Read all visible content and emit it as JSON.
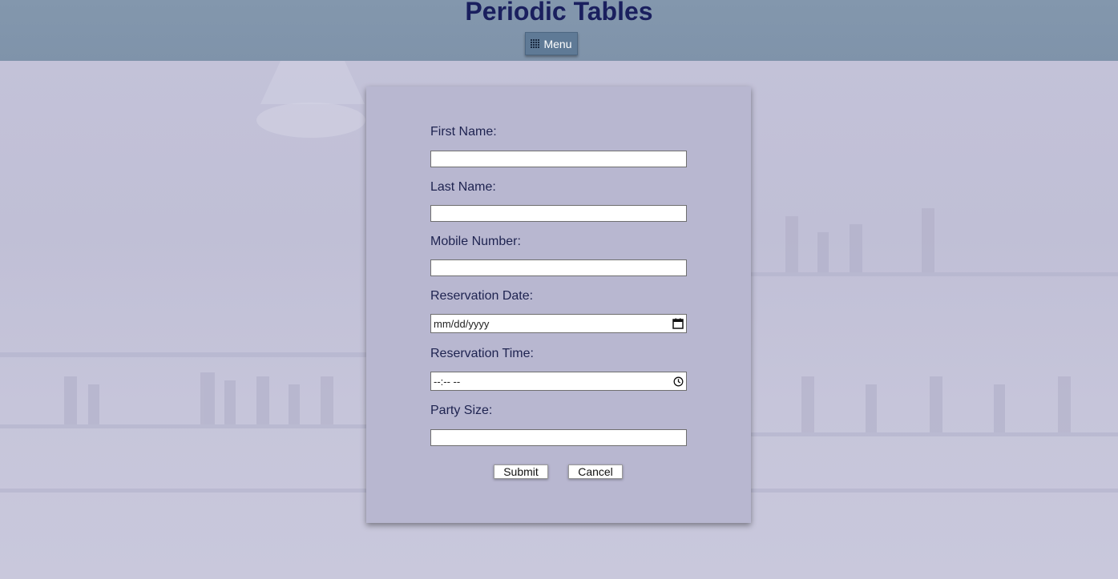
{
  "header": {
    "title": "Periodic Tables",
    "menu_label": "Menu",
    "menu_icon": "grid-icon"
  },
  "form": {
    "fields": [
      {
        "label": "First Name:",
        "value": "",
        "placeholder": ""
      },
      {
        "label": "Last Name:",
        "value": "",
        "placeholder": ""
      },
      {
        "label": "Mobile Number:",
        "value": "",
        "placeholder": ""
      },
      {
        "label": "Reservation Date:",
        "value": "",
        "placeholder": "mm/dd/yyyy",
        "icon": "calendar-icon"
      },
      {
        "label": "Reservation Time:",
        "value": "",
        "placeholder": "--:-- --",
        "icon": "clock-icon"
      },
      {
        "label": "Party Size:",
        "value": "",
        "placeholder": ""
      }
    ],
    "submit_label": "Submit",
    "cancel_label": "Cancel"
  },
  "colors": {
    "header_bg": "#8397ad",
    "title_text": "#1a1f5e",
    "menu_button_bg": "#5f7a96",
    "card_bg": "#b7b6d0",
    "label_text": "#1e2350",
    "page_bg": "#c4c3d9"
  }
}
